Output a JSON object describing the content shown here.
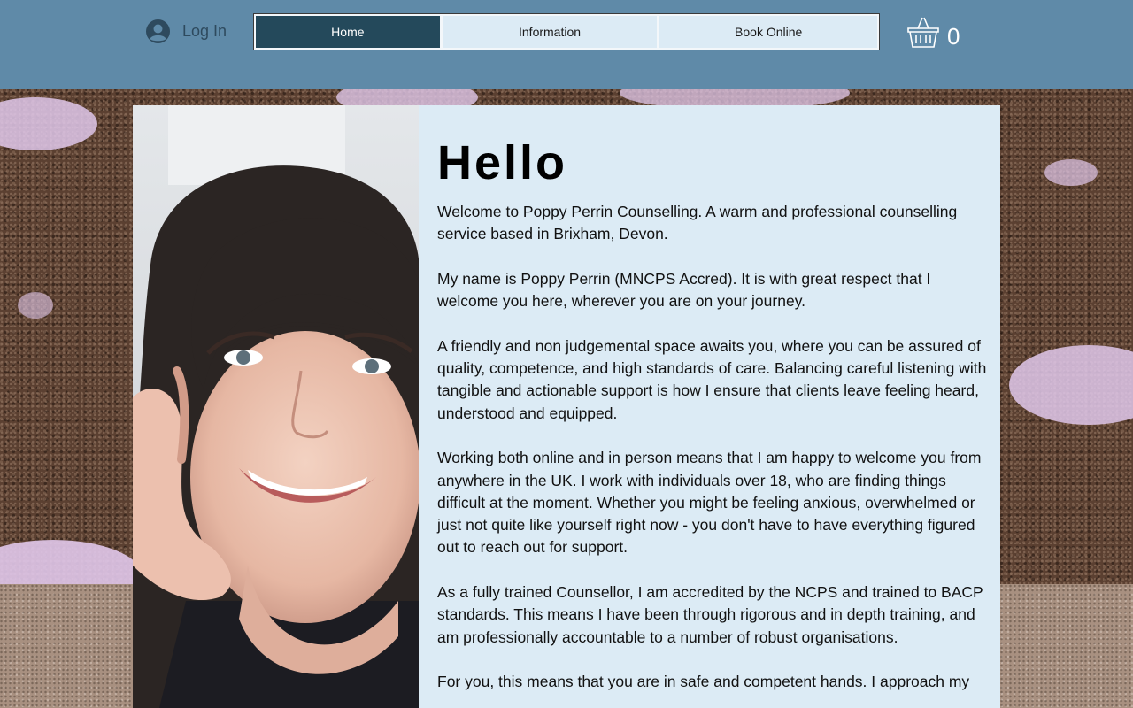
{
  "header": {
    "login_label": "Log In",
    "nav": [
      {
        "label": "Home",
        "active": true
      },
      {
        "label": "Information",
        "active": false
      },
      {
        "label": "Book Online",
        "active": false
      }
    ],
    "cart_count": "0"
  },
  "icons": {
    "login": "user-avatar-icon",
    "cart": "shopping-basket-icon"
  },
  "colors": {
    "header_bg": "#5f8aa8",
    "nav_active_bg": "#24495b",
    "nav_bg": "#dcebf5",
    "panel_bg": "#dcebf5"
  },
  "main": {
    "heading": "Hello",
    "paragraphs": [
      "Welcome to Poppy Perrin Counselling. A warm and professional counselling service based in Brixham, Devon.",
      "My name is Poppy Perrin (MNCPS Accred). It is with great respect that I welcome you here, wherever you are on your journey.",
      "A friendly and non judgemental space awaits you, where you can be assured of quality, competence, and high standards of care. Balancing careful listening with tangible and actionable support is how I ensure that clients leave feeling heard, understood and equipped.",
      "Working both online and in person means that I am happy to welcome you from anywhere in the UK. I work with individuals over 18, who are finding things difficult at the moment. Whether you might be feeling anxious, overwhelmed or just not quite like yourself right now - you don't have to have everything figured out to reach out for support.",
      "As a fully trained Counsellor, I am accredited by the NCPS and trained to BACP standards. This means I have been through rigorous and in depth training, and am professionally accountable to a number of robust organisations.",
      "For you, this means that you are in safe and competent hands. I approach my"
    ]
  }
}
